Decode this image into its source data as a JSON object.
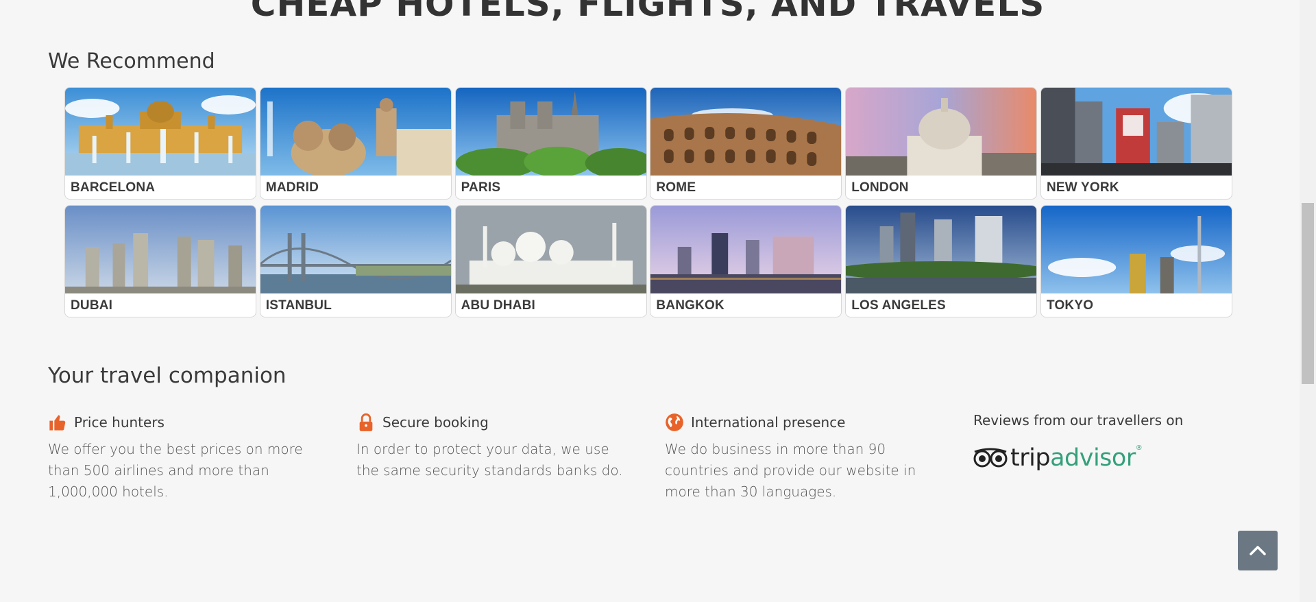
{
  "hero": {
    "title": "CHEAP HOTELS, FLIGHTS, AND TRAVELS"
  },
  "recommend": {
    "title": "We Recommend",
    "cities": [
      {
        "label": "BARCELONA"
      },
      {
        "label": "MADRID"
      },
      {
        "label": "PARIS"
      },
      {
        "label": "ROME"
      },
      {
        "label": "LONDON"
      },
      {
        "label": "NEW YORK"
      },
      {
        "label": "DUBAI"
      },
      {
        "label": "ISTANBUL"
      },
      {
        "label": "ABU DHABI"
      },
      {
        "label": "BANGKOK"
      },
      {
        "label": "LOS ANGELES"
      },
      {
        "label": "TOKYO"
      }
    ]
  },
  "companion": {
    "title": "Your travel companion",
    "features": [
      {
        "icon": "thumbs-up-icon",
        "title": "Price hunters",
        "desc": "We offer you the best prices on more than 500 airlines and more than 1,000,000 hotels."
      },
      {
        "icon": "lock-icon",
        "title": "Secure booking",
        "desc": "In order to protect your data, we use the same security standards banks do."
      },
      {
        "icon": "globe-icon",
        "title": "International presence",
        "desc": "We do business in more than 90 countries and provide our website in more than 30 languages."
      }
    ],
    "reviews": {
      "text": "Reviews from our travellers on",
      "logo_trip": "trip",
      "logo_advisor": "advisor",
      "logo_reg": "®"
    }
  },
  "colors": {
    "accent": "#e8632a",
    "background": "#f6f6f6",
    "tripadvisor_green": "#34a07b",
    "scroll_button": "#6b7884"
  }
}
